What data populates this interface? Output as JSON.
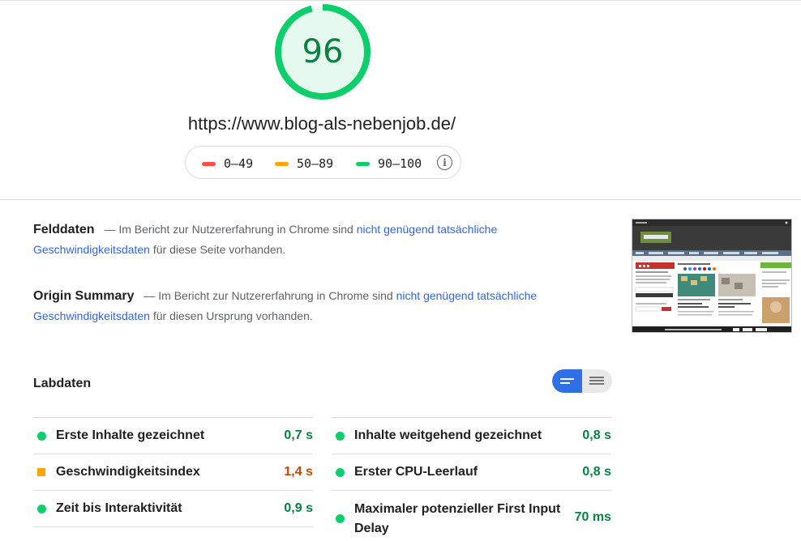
{
  "score": {
    "value": "96",
    "fraction": 0.96,
    "color": "#0cce6b"
  },
  "url": "https://www.blog-als-nebenjob.de/",
  "legend": {
    "ranges": [
      {
        "label": "0–49",
        "color": "#ff4e42"
      },
      {
        "label": "50–89",
        "color": "#ffa400"
      },
      {
        "label": "90–100",
        "color": "#0cce6b"
      }
    ],
    "info_icon": "info-icon"
  },
  "field_data": {
    "title": "Felddaten",
    "text_before": "— Im Bericht zur Nutzererfahrung in Chrome sind",
    "link": "nicht genügend tatsächliche Geschwindigkeitsdaten",
    "text_after": "für diese Seite vorhanden."
  },
  "origin_summary": {
    "title": "Origin Summary",
    "text_before": "— Im Bericht zur Nutzererfahrung in Chrome sind",
    "link": "nicht genügend tatsächliche Geschwindigkeitsdaten",
    "text_after": "für diesen Ursprung vorhanden."
  },
  "lab_data": {
    "title": "Labdaten",
    "view_toggle": [
      "list-compact-icon",
      "list-expanded-icon"
    ],
    "metrics_left": [
      {
        "label": "Erste Inhalte gezeichnet",
        "value": "0,7 s",
        "status": "pass"
      },
      {
        "label": "Geschwindigkeitsindex",
        "value": "1,4 s",
        "status": "average"
      },
      {
        "label": "Zeit bis Interaktivität",
        "value": "0,9 s",
        "status": "pass"
      }
    ],
    "metrics_right": [
      {
        "label": "Inhalte weitgehend gezeichnet",
        "value": "0,8 s",
        "status": "pass"
      },
      {
        "label": "Erster CPU-Leerlauf",
        "value": "0,8 s",
        "status": "pass"
      },
      {
        "label": "Maximaler potenzieller First Input Delay",
        "value": "70 ms",
        "status": "pass"
      }
    ]
  }
}
